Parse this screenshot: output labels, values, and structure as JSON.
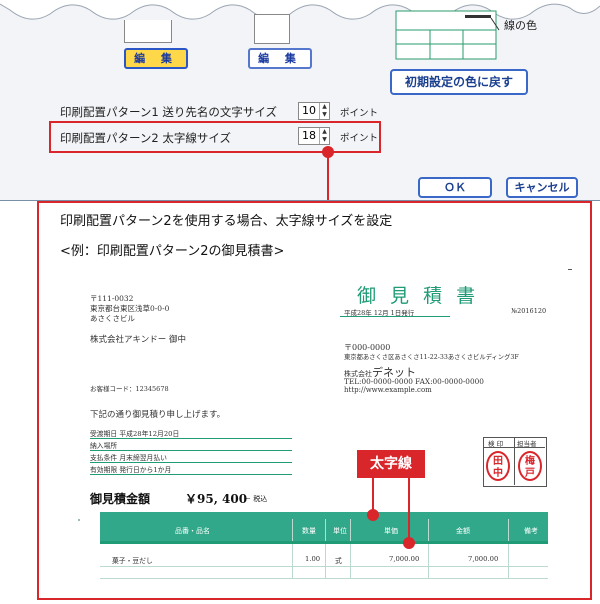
{
  "dialog": {
    "line_color_label": "線の色",
    "edit_button_1": "編 集",
    "edit_button_2": "編 集",
    "reset_color_button": "初期設定の色に戻す",
    "row1_label": "印刷配置パターン1 送り先名の文字サイズ",
    "row1_value": "10",
    "row2_label": "印刷配置パターン2 太字線サイズ",
    "row2_value": "18",
    "unit_label": "ポイント",
    "ok_button": "ＯＫ",
    "cancel_button": "キャンセル"
  },
  "callout": {
    "heading": "印刷配置パターン2を使用する場合、太字線サイズを設定",
    "subheading": "<例：印刷配置パターン2の御見積書>",
    "annotation": "太字線"
  },
  "invoice": {
    "title": "御 見 積 書",
    "issue_date": "平成28年 12月 1日発行",
    "number": "№2016120",
    "to_postal": "〒111-0032",
    "to_address1": "東京都台東区浅草0-0-0",
    "to_address2": "あさくさビル",
    "to_company": "株式会社アキンドー 御中",
    "from_postal": "〒000-0000",
    "from_address": "東京都あさくさ区あさくさ11-22-33あさくさビルディング3F",
    "from_company_prefix": "株式会社",
    "from_company": "デネット",
    "from_tel": "TEL:00-0000-0000  FAX:00-0000-0000",
    "from_url": "http://www.example.com",
    "customer_code": "お客様コード：12345678",
    "greeting": "下記の通り御見積り申し上げます。",
    "terms": [
      "受渡期日  平成28年12月20日",
      "納入場所",
      "支払条件  月末締翌月払い",
      "有効期限  発行日から1か月"
    ],
    "stamp_headers": [
      "検 印",
      "担当者"
    ],
    "stamp_1": "田中",
    "stamp_2": "梅戸",
    "total_label": "御見積金額",
    "total_value": "￥95, 400",
    "total_note": "－ 税込",
    "table_headers": [
      "品番・品名",
      "数量",
      "単位",
      "単価",
      "金額",
      "備考"
    ],
    "row": {
      "name": "菓子・豆だし",
      "qty": "1.00",
      "unit": "式",
      "price": "7,000.00",
      "amount": "7,000.00"
    },
    "colors": {
      "accent": "#1f9b76",
      "callout": "#d9262b"
    }
  }
}
